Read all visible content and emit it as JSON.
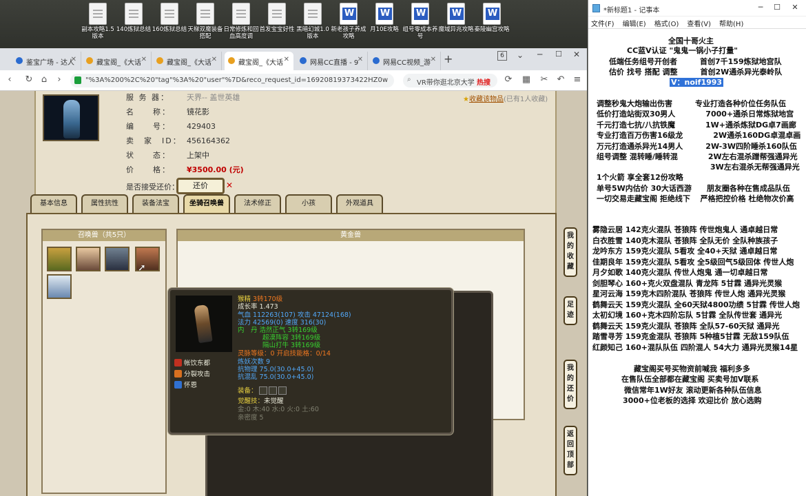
{
  "desktop": {
    "icons": [
      {
        "label": "副本攻略1.5版本",
        "type": "doc"
      },
      {
        "label": "140炼狱总结",
        "type": "doc"
      },
      {
        "label": "160炼狱总结",
        "type": "doc"
      },
      {
        "label": "天梯双魔装备搭配",
        "type": "doc"
      },
      {
        "label": "日常修炼和回血高度调",
        "type": "doc"
      },
      {
        "label": "首发宝宝好性",
        "type": "doc"
      },
      {
        "label": "黑暗幻城1.0版本",
        "type": "doc"
      },
      {
        "label": "新老孩子养成攻略",
        "type": "word"
      },
      {
        "label": "月10E攻略",
        "type": "word"
      },
      {
        "label": "组号零成本养号",
        "type": "word"
      },
      {
        "label": "魔域异兆攻略",
        "type": "word"
      },
      {
        "label": "秦陵幽宫攻略",
        "type": "word"
      }
    ]
  },
  "browser": {
    "tabs": [
      {
        "label": "鉴宝广场 - 达人"
      },
      {
        "label": "藏宝阁_《大话"
      },
      {
        "label": "藏宝阁_《大话"
      },
      {
        "label": "藏宝阁_《大话"
      },
      {
        "label": "网易CC直播 - 9"
      },
      {
        "label": "网易CC视频_游"
      }
    ],
    "tab_count": "6",
    "url": "\"%3A%200%2C%20\"tag\"%3A%20\"user\"%7D&reco_request_id=16920819373422HZ0w",
    "search_text": "VR带你逛北京大学",
    "search_hot": "热搜"
  },
  "listing": {
    "server_label": "服 务 器：",
    "server_value": "天界-- 盖世英雄",
    "name_label": "名　　称：",
    "name_value": "镜花影",
    "id_label": "编　　号：",
    "id_value": "429403",
    "seller_label": "卖　家　ID：",
    "seller_value": "456164362",
    "status_label": "状　　态：",
    "status_value": "上架中",
    "price_label": "价　　格：",
    "price_value": "¥3500.00 (元)",
    "bargain_label": "是否接受还价：",
    "bargain_button": "还价",
    "favorite_link": "收藏该物品",
    "favorite_count": "(已有1人收藏)"
  },
  "game_tabs": [
    "基本信息",
    "属性抗性",
    "装备法宝",
    "坐骑召唤兽",
    "法术修正",
    "小孩",
    "外观道具"
  ],
  "active_tab_index": 3,
  "pet_panel": {
    "title": "召唤兽（共5只）"
  },
  "gold_panel": {
    "title": "黄金兽"
  },
  "tooltip": {
    "name": "猴精",
    "level": "3转170级",
    "growth": "成长率 1.473",
    "hp": "气血 112263(107) 攻击 47124(168)",
    "mp": "法力 42569(0) 速度 316(30)",
    "inner1": "内　丹 浩然正气 3转169级",
    "inner2": "超漠阵容 3转169级",
    "inner3": "隔山打牛 3转169级",
    "spirit": "灵脉等级：0 开启技能格：0/14",
    "refine": "炼妖次数 9",
    "resist_phys": "抗物理 75.0(30.0+45.0)",
    "resist_chaos": "抗混乱 75.0(30.0+45.0)",
    "equip_label": "装备：",
    "awaken_label": "觉醒技：",
    "awaken_value": "未觉醒",
    "elements": "金:0 木:40 水:0 火:0 土:60",
    "closeness": "亲密度 5",
    "skills": [
      "帐饮东都",
      "分裂攻击",
      "怀恩"
    ]
  },
  "right_sidebar": [
    "我的收藏",
    "足迹",
    "我的还价",
    "返回顶部"
  ],
  "notepad": {
    "title": "*新标题1 - 记事本",
    "menu": [
      "文件(F)",
      "编辑(E)",
      "格式(O)",
      "查看(V)",
      "帮助(H)"
    ],
    "lines": [
      "全国十哥火主",
      "CC蓝V认证 \"鬼鬼一锅小子打量\"",
      "低端任务组号开创者　　　首创7千159炼狱地宫队",
      "估价 找号 搭配 调整　　　首创2W通杀异光泰岭队",
      "V：noif1993",
      "调整秒鬼大炮输出伤害　　　专业打造各种价位任务队伍",
      "低价打造站街双30男人　　　　7000+通杀日常炼狱地宫",
      "千元打造七抗/八抗铁魔　　　　1W+通杀炼狱DG卓7画廊",
      "专业打造百万伤害16级龙　　　　2W通杀160DG卓混卓画",
      "万元打造通杀异光14男人　　　2W-3W四阶睡杀160队伍",
      "组号调整 混转睡/睡转混　　　　2W左右混杀蹭帮强通异光",
      "　　　　　　　　　　　　　　　3W左右混杀无帮强通异光",
      "1个火箭 享全套12份攻略",
      "单号5W内估价 30大话西游　　朋友圈各种在售成品队伍",
      "一切交易走藏宝阁 拒绝线下　 严格把控价格 杜绝物次价高",
      "雾隐云居 142克火混队 苍狼阵 传世炮鬼人 通卓越日常",
      "白衣胜雪 140克木混队 苍狼阵 全队无价 全队种族孩子",
      "龙吟东方 159克火混队 5看攻 全40+天狱 通卓越日常",
      "佳期良年 159克火混队 5看攻 全5级回气5级回体 传世人炮",
      "月夕如歌 140克火混队 传世人炮鬼 通一切卓越日常",
      "剑胆琴心 160+克火双盘混队 青龙阵 5甘霖 通异光灵猴",
      "星河云海 159克木四阶混队 苍狼阵 传世人炮 通异光灵猴",
      "鹤舞云天 159克火混队 全60天狱4800功绩 5甘霖 传世人炮",
      "太初幻境 160+克木四阶忘队 5甘霖 全队传世套 通异光",
      "鹤舞云天 159克火混队 苍狼阵 全队57-60天狱 通异光",
      "踏雪寻芳 159克金混队 苍狼阵 5种植5甘霖 无敌159队伍",
      "红颜知己 160+混队队伍 四阶混人 54大力 通异光灵猴14星",
      "藏宝阁买号买物资前喊我 福利多多",
      "在售队伍全部都在藏宝阁 买卖号加V联系",
      "微信常年1W好友 滚动更新各种队伍信息",
      "3000+位老板的选择 欢迎比价 放心选购"
    ]
  },
  "colors": {
    "selection": "#3072d8",
    "price": "#c00000",
    "skill_orange": "#f07820",
    "blue_text": "#52a8f8",
    "green_text": "#38d030"
  }
}
